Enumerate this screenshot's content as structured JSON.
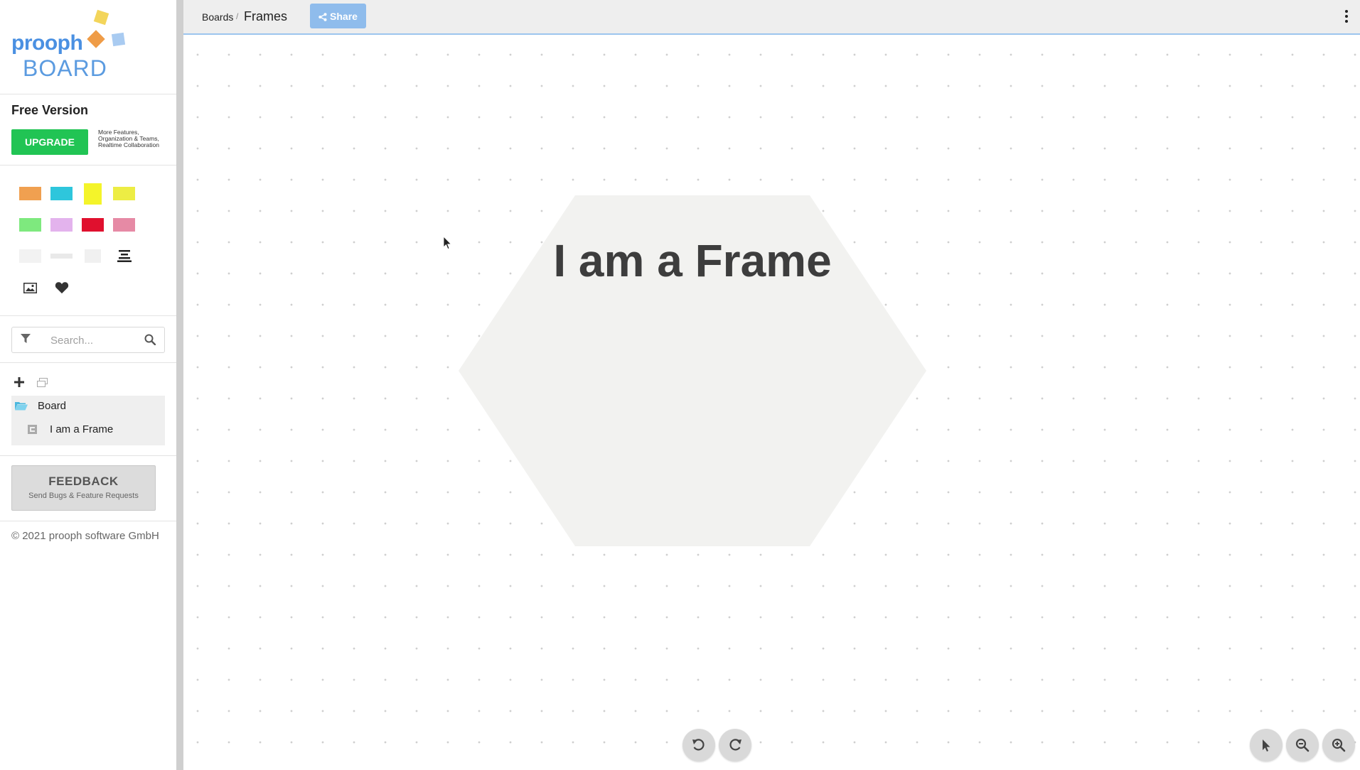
{
  "logo": {
    "word_top": "prooph",
    "word_bottom": "BOARD",
    "colors": {
      "blue": "#4a90e2",
      "yellow": "#f3d55b",
      "orange": "#ef9c47",
      "lightblue": "#a9cbf1"
    }
  },
  "plan": {
    "title": "Free Version",
    "upgrade_label": "UPGRADE",
    "upgrade_note": "More Features, Organization & Teams, Realtime Collaboration"
  },
  "palette": {
    "row1": [
      "#f0a050",
      "#2ec6dc",
      "#f4f42a",
      "#eded44"
    ],
    "row2": [
      "#7ee97e",
      "#e3b3ed",
      "#e0102e",
      "#e68aa5"
    ],
    "row3_icons": [
      "blank-card-icon",
      "line-icon",
      "blank-square-icon",
      "text-align-icon"
    ],
    "row4_icons": [
      "image-icon",
      "heart-icon"
    ]
  },
  "search": {
    "placeholder": "Search..."
  },
  "tree": {
    "root_label": "Board",
    "child_label": "I am a Frame"
  },
  "feedback": {
    "title": "FEEDBACK",
    "subtitle": "Send Bugs & Feature Requests"
  },
  "copyright": "© 2021 prooph software GmbH",
  "topbar": {
    "breadcrumb_root": "Boards",
    "breadcrumb_sep": "/",
    "breadcrumb_current": "Frames",
    "share_label": "Share"
  },
  "canvas": {
    "frame_title": "I am a Frame",
    "frame_fill": "#f2f2f0"
  }
}
